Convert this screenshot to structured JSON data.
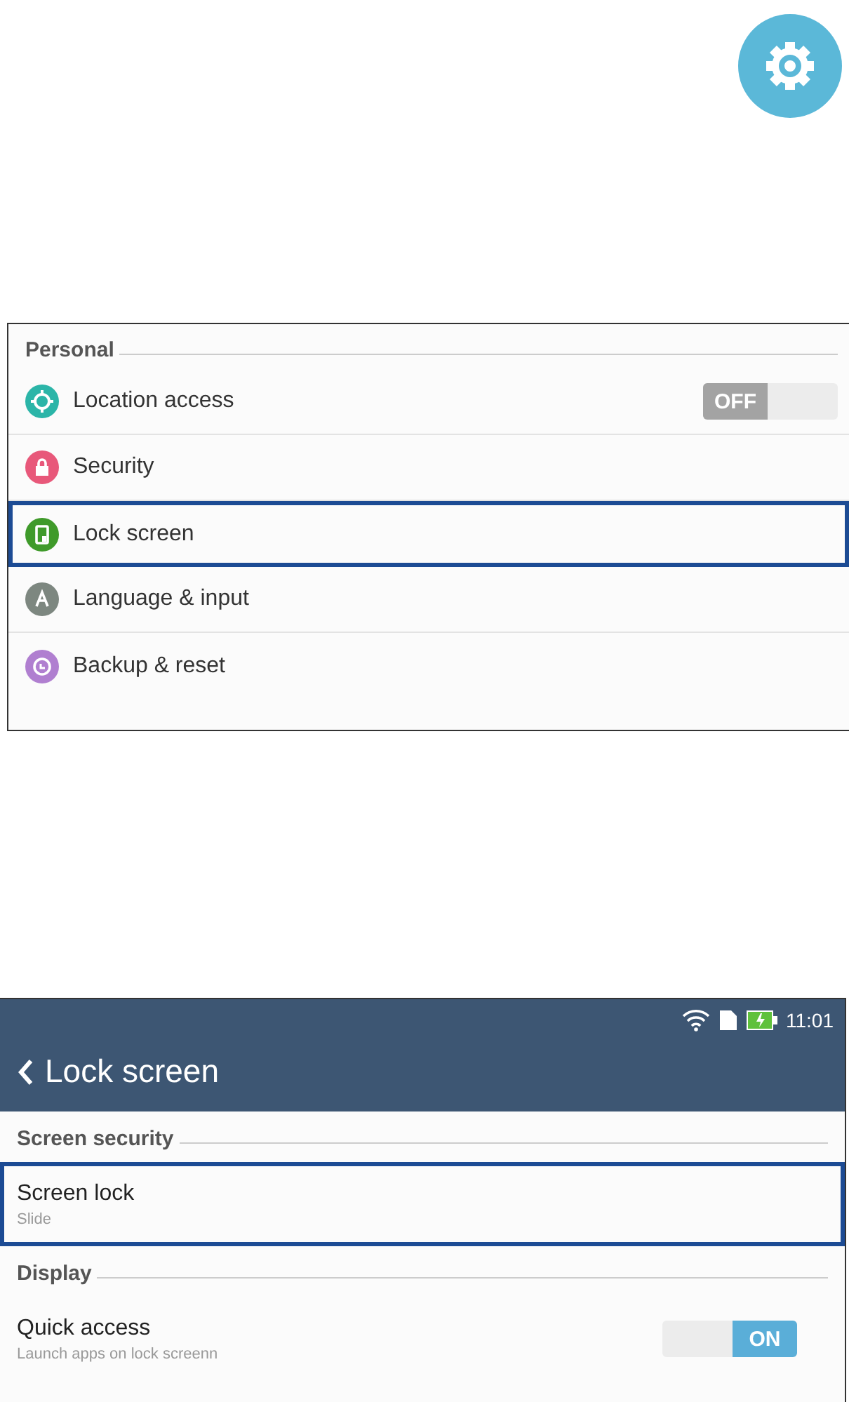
{
  "personal_panel": {
    "section": "Personal",
    "items": [
      {
        "label": "Location access",
        "color": "#2bb5a8",
        "highlighted": false,
        "toggle": {
          "label": "OFF",
          "on": false
        }
      },
      {
        "label": "Security",
        "color": "#e8587a",
        "highlighted": false
      },
      {
        "label": "Lock screen",
        "color": "#3f9a2a",
        "highlighted": true
      },
      {
        "label": "Language & input",
        "color": "#7d8780",
        "highlighted": false
      },
      {
        "label": "Backup & reset",
        "color": "#b07fd0",
        "highlighted": false
      }
    ]
  },
  "lock_screen_panel": {
    "status_bar": {
      "time": "11:01"
    },
    "title": "Lock screen",
    "sections": [
      {
        "header": "Screen security",
        "items": [
          {
            "title": "Screen lock",
            "subtitle": "Slide",
            "highlighted": true
          }
        ]
      },
      {
        "header": "Display",
        "items": [
          {
            "title": "Quick access",
            "subtitle": "Launch apps on lock screenn",
            "highlighted": false,
            "toggle": {
              "label": "ON",
              "on": true
            }
          }
        ]
      }
    ]
  }
}
